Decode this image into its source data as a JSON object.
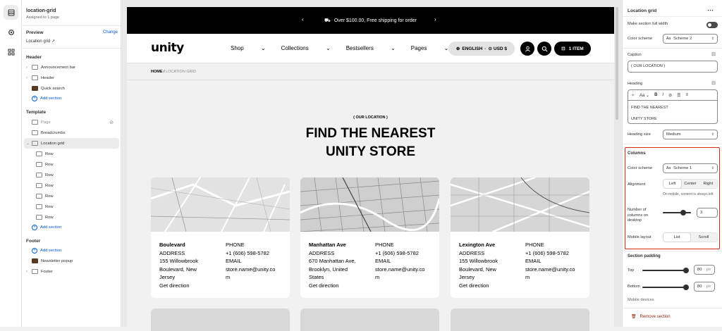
{
  "left_panel": {
    "section_title": "location-grid",
    "assigned": "Assigned to 1 page",
    "preview_label": "Preview",
    "change_label": "Change",
    "preview_value": "Location grid",
    "header_group": "Header",
    "header_items": [
      "Announcement bar",
      "Header",
      "Quick search"
    ],
    "add_section": "Add section",
    "template_group": "Template",
    "template_items": [
      "Page",
      "Breadcrumbs",
      "Location grid"
    ],
    "rows": [
      "Row",
      "Row",
      "Row",
      "Row",
      "Row",
      "Row",
      "Row"
    ],
    "footer_group": "Footer",
    "footer_items": [
      "Newsletter popup",
      "Footer"
    ]
  },
  "store": {
    "announcement": "Over $100.00, Free shipping for order",
    "logo": "unity",
    "menu": [
      "Shop",
      "Collections",
      "Bestsellers",
      "Pages"
    ],
    "locale": "ENGLISH",
    "currency": "USD  $",
    "cart": "1  ITEM",
    "breadcrumb_home": "HOME",
    "breadcrumb_current": "LOCATION GRID",
    "caption": "( OUR LOCATION )",
    "heading_line1": "FIND THE NEAREST",
    "heading_line2": "UNITY STORE",
    "locations": [
      {
        "name": "Boulevard",
        "address_label": "ADDRESS",
        "address": [
          "155 Willowbrook",
          "Boulevard, New",
          "Jersey"
        ],
        "direction": "Get direction",
        "phone_label": "PHONE",
        "phone": "+1 (606) 598-5782",
        "email_label": "EMAIL",
        "email": [
          "store.name@unity.co",
          "m"
        ]
      },
      {
        "name": "Manhattan Ave",
        "address_label": "ADDRESS",
        "address": [
          "670 Manhattan Ave,",
          "Brooklyn, United",
          "States"
        ],
        "direction": "Get direction",
        "phone_label": "PHONE",
        "phone": "+1 (606) 598-5782",
        "email_label": "EMAIL",
        "email": [
          "store.name@unity.co",
          "m"
        ]
      },
      {
        "name": "Lexington Ave",
        "address_label": "ADDRESS",
        "address": [
          "155 Willowbrook",
          "Boulevard, New",
          "Jersey"
        ],
        "direction": "Get direction",
        "phone_label": "PHONE",
        "phone": "+1 (606) 598-5782",
        "email_label": "EMAIL",
        "email": [
          "store.name@unity.co",
          "m"
        ]
      }
    ]
  },
  "settings": {
    "title": "Location grid",
    "full_width_label": "Make section full width",
    "color_scheme_label": "Color scheme",
    "color_scheme_value": "Scheme 2",
    "caption_label": "Caption",
    "caption_value": "( OUR LOCATION )",
    "heading_label": "Heading",
    "heading_value_1": "FIND THE NEAREST",
    "heading_value_2": "UNITY STORE",
    "heading_size_label": "Heading size",
    "heading_size_value": "Medium",
    "columns_title": "Columns",
    "col_color_scheme_label": "Color scheme",
    "col_color_scheme_value": "Scheme 1",
    "alignment_label": "Alignment",
    "alignment_options": [
      "Left",
      "Center",
      "Right"
    ],
    "alignment_selected": "Left",
    "mobile_note": "On mobile, content is always left",
    "num_columns_label": "Number of columns on desktop",
    "num_columns_value": "3",
    "mobile_layout_label": "Mobile layout",
    "mobile_layout_options": [
      "List",
      "Scroll"
    ],
    "mobile_layout_selected": "List",
    "padding_title": "Section padding",
    "top_label": "Top",
    "top_value": "80",
    "bottom_label": "Bottom",
    "bottom_value": "80",
    "unit": "px",
    "mobile_devices_label": "Mobile devices",
    "remove_label": "Remove section"
  },
  "colors": {
    "highlight": "#d72c0d",
    "link": "#005bd3",
    "black": "#000000"
  }
}
